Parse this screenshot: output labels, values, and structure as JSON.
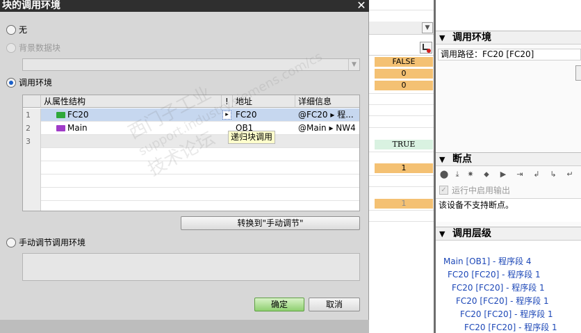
{
  "dialog": {
    "title": "块的调用环境",
    "close_glyph": "✕",
    "options": {
      "none_label": "无",
      "background_db_label": "背景数据块",
      "call_env_label": "调用环境",
      "manual_label": "手动调节调用环境"
    },
    "table": {
      "columns": [
        "从属性结构",
        "!",
        "地址",
        "详细信息"
      ],
      "rows": [
        {
          "num": "1",
          "name": "FC20",
          "flag": "▸",
          "address": "FC20",
          "detail": "@FC20 ▸ 程..."
        },
        {
          "num": "2",
          "name": "Main",
          "flag": "",
          "address": "OB1",
          "detail": "@Main ▸ NW4"
        },
        {
          "num": "3",
          "name": "",
          "flag": "",
          "address": "",
          "detail": ""
        }
      ],
      "tooltip": "递归块调用"
    },
    "convert_button": "转换到\"手动调节\"",
    "ok_button": "确定",
    "cancel_button": "取消"
  },
  "editor": {
    "values": {
      "v1": "FALSE",
      "v2": "0",
      "v3": "0",
      "v4": "TRUE",
      "v5": "1",
      "v6": "1"
    }
  },
  "panel": {
    "call_env": {
      "title": "调用环境",
      "path": "调用路径：FC20 [FC20]"
    },
    "breakpoints": {
      "title": "断点",
      "checkbox_label": "运行中启用输出",
      "message": "该设备不支持断点。"
    },
    "hierarchy": {
      "title": "调用层级",
      "items": [
        "Main [OB1] - 程序段 4",
        "FC20 [FC20] - 程序段 1",
        "FC20 [FC20] - 程序段 1",
        "FC20 [FC20] - 程序段 1",
        "FC20 [FC20] - 程序段 1",
        "FC20 [FC20] - 程序段 1"
      ]
    }
  },
  "watermark": {
    "line1": "西门子工业",
    "line2": "support.industry.siemens.com/cs",
    "line3": "技术论坛"
  },
  "colors": {
    "fc_icon": "#2fa83a",
    "ob_icon": "#a03cc8",
    "hierarchy_link": "#1c47b7",
    "value_orange": "#f4c173"
  }
}
